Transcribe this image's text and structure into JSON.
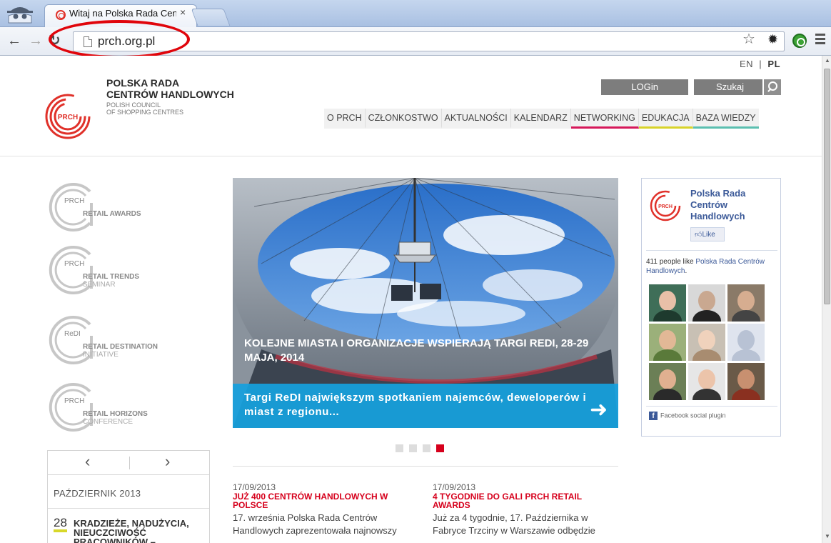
{
  "browser": {
    "tab_title": "Witaj na Polska Rada Cent",
    "tab_close": "×",
    "url": "prch.org.pl"
  },
  "site": {
    "lang_en": "EN",
    "lang_sep": "|",
    "lang_pl": "PL",
    "logo_line1": "POLSKA RADA",
    "logo_line2": "CENTRÓW HANDLOWYCH",
    "logo_line3": "POLISH COUNCIL",
    "logo_line4": "OF SHOPPING CENTRES",
    "logo_mark": "PRCH",
    "login_label": "LOGin",
    "search_label": "Szukaj",
    "nav": [
      {
        "label": "O PRCH",
        "accent": ""
      },
      {
        "label": "CZŁONKOSTWO",
        "accent": ""
      },
      {
        "label": "AKTUALNOŚCI",
        "accent": ""
      },
      {
        "label": "KALENDARZ",
        "accent": ""
      },
      {
        "label": "NETWORKING",
        "accent": "#d6185a"
      },
      {
        "label": "EDUKACJA",
        "accent": "#d8d32a"
      },
      {
        "label": "BAZA WIEDZY",
        "accent": "#5bbfb0"
      }
    ]
  },
  "events": [
    {
      "tag": "PRCH",
      "name": "RETAIL AWARDS",
      "sub": ""
    },
    {
      "tag": "PRCH",
      "name": "RETAIL TRENDS",
      "sub": "SEMINAR"
    },
    {
      "tag": "ReDI",
      "name": "RETAIL DESTINATION",
      "sub": "INITIATIVE"
    },
    {
      "tag": "PRCH",
      "name": "RETAIL HORIZONS",
      "sub": "CONFERENCE"
    }
  ],
  "calendar": {
    "prev": "‹",
    "next": "›",
    "month": "PAŹDZIERNIK 2013",
    "day": "28",
    "event": "KRADZIEŻE, NADUŻYCIA, NIEUCZCIWOŚĆ PRACOWNIKÓW –"
  },
  "slider": {
    "caption": "KOLEJNE MIASTA I ORGANIZACJE WSPIERAJĄ TARGI REDI, 28-29 MAJA, 2014",
    "description": "Targi ReDI największym spotkaniem najemców, deweloperów i miast z regionu...",
    "arrow": "➜",
    "slide_count": 4,
    "active_slide": 4
  },
  "news": [
    {
      "date": "17/09/2013",
      "title": "JUŻ 400 CENTRÓW HANDLOWYCH W POLSCE",
      "body": "17. września Polska Rada Centrów Handlowych zaprezentowała najnowszy"
    },
    {
      "date": "17/09/2013",
      "title": "4 TYGODNIE DO GALI PRCH RETAIL AWARDS",
      "body": "Już za 4 tygodnie, 17. Października w Fabryce Trzciny w Warszawie odbędzie"
    }
  ],
  "facebook": {
    "page_name": "Polska Rada Centrów Handlowych",
    "like_label": "Like",
    "count_text": "411 people like ",
    "count_link": "Polska Rada Centrów Handlowych",
    "count_end": ".",
    "footer": "Facebook social plugin"
  },
  "colors": {
    "brand_red": "#d6001c",
    "slide_blue": "#16a0de",
    "fb_blue": "#3b5998"
  }
}
